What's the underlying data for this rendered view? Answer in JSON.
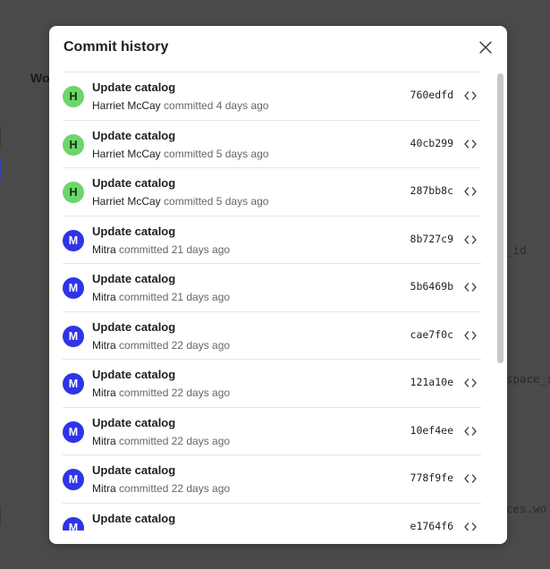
{
  "background": {
    "left_text": "Wo",
    "right_fragments": [
      "_id",
      "space_i",
      "ces.wo"
    ]
  },
  "modal": {
    "title": "Commit history",
    "commits": [
      {
        "avatar_initial": "H",
        "avatar_color": "#6dd56c",
        "message": "Update catalog",
        "author": "Harriet McCay",
        "action": "committed 4 days ago",
        "sha": "760edfd"
      },
      {
        "avatar_initial": "H",
        "avatar_color": "#6dd56c",
        "message": "Update catalog",
        "author": "Harriet McCay",
        "action": "committed 5 days ago",
        "sha": "40cb299"
      },
      {
        "avatar_initial": "H",
        "avatar_color": "#6dd56c",
        "message": "Update catalog",
        "author": "Harriet McCay",
        "action": "committed 5 days ago",
        "sha": "287bb8c"
      },
      {
        "avatar_initial": "M",
        "avatar_color": "#2f34e6",
        "message": "Update catalog",
        "author": "Mitra",
        "action": "committed 21 days ago",
        "sha": "8b727c9"
      },
      {
        "avatar_initial": "M",
        "avatar_color": "#2f34e6",
        "message": "Update catalog",
        "author": "Mitra",
        "action": "committed 21 days ago",
        "sha": "5b6469b"
      },
      {
        "avatar_initial": "M",
        "avatar_color": "#2f34e6",
        "message": "Update catalog",
        "author": "Mitra",
        "action": "committed 22 days ago",
        "sha": "cae7f0c"
      },
      {
        "avatar_initial": "M",
        "avatar_color": "#2f34e6",
        "message": "Update catalog",
        "author": "Mitra",
        "action": "committed 22 days ago",
        "sha": "121a10e"
      },
      {
        "avatar_initial": "M",
        "avatar_color": "#2f34e6",
        "message": "Update catalog",
        "author": "Mitra",
        "action": "committed 22 days ago",
        "sha": "10ef4ee"
      },
      {
        "avatar_initial": "M",
        "avatar_color": "#2f34e6",
        "message": "Update catalog",
        "author": "Mitra",
        "action": "committed 22 days ago",
        "sha": "778f9fe"
      },
      {
        "avatar_initial": "M",
        "avatar_color": "#2f34e6",
        "message": "Update catalog",
        "author": "",
        "action": "",
        "sha": "e1764f6"
      }
    ]
  },
  "icons": {
    "close": "close-icon",
    "browse_code": "code-brackets-icon"
  }
}
